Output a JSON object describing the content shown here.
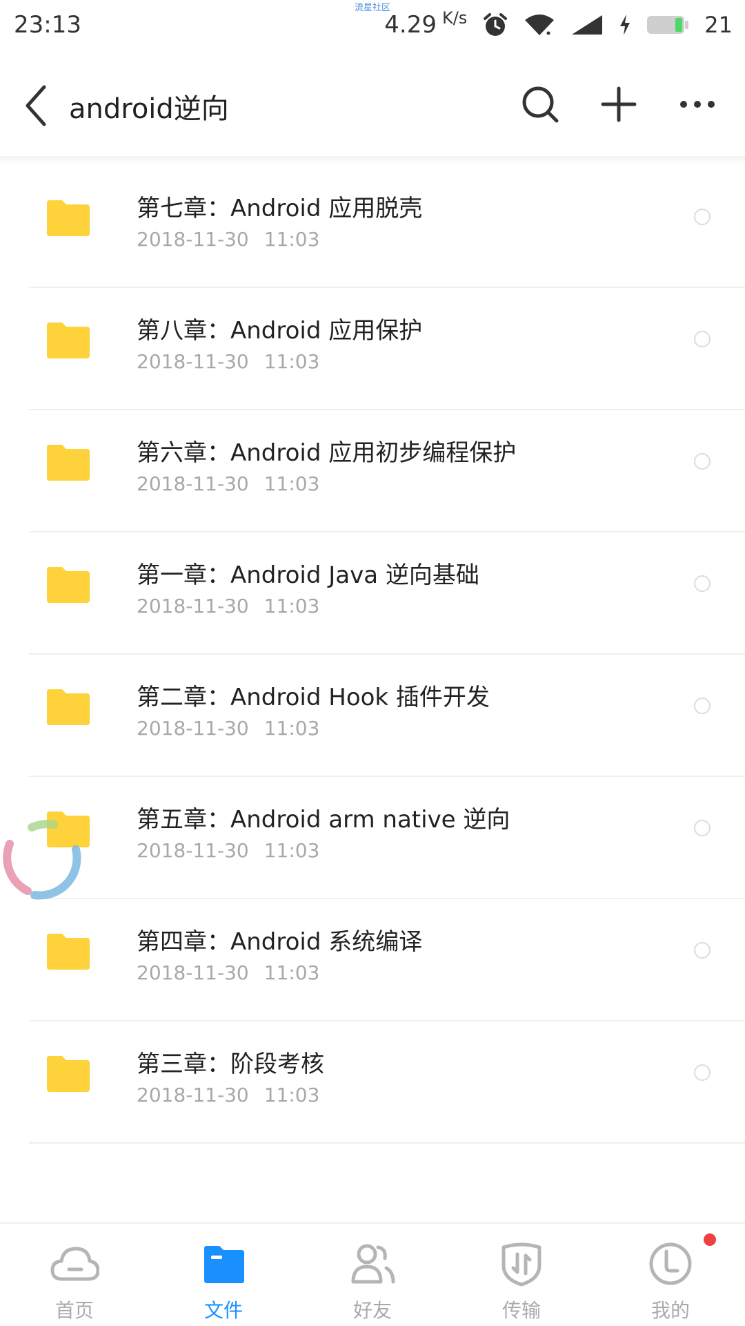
{
  "status_bar": {
    "time": "23:13",
    "watermark": "流星社区",
    "speed": "4.29",
    "speed_unit": "K/s",
    "battery": "21"
  },
  "header": {
    "title": "android逆向"
  },
  "folders": [
    {
      "name": "第七章：Android 应用脱壳",
      "date": "2018-11-30",
      "time": "11:03"
    },
    {
      "name": "第八章：Android 应用保护",
      "date": "2018-11-30",
      "time": "11:03"
    },
    {
      "name": "第六章：Android 应用初步编程保护",
      "date": "2018-11-30",
      "time": "11:03"
    },
    {
      "name": "第一章：Android Java 逆向基础",
      "date": "2018-11-30",
      "time": "11:03"
    },
    {
      "name": "第二章：Android Hook 插件开发",
      "date": "2018-11-30",
      "time": "11:03"
    },
    {
      "name": "第五章：Android arm native 逆向",
      "date": "2018-11-30",
      "time": "11:03"
    },
    {
      "name": "第四章：Android 系统编译",
      "date": "2018-11-30",
      "time": "11:03"
    },
    {
      "name": "第三章：阶段考核",
      "date": "2018-11-30",
      "time": "11:03"
    }
  ],
  "bottom_nav": [
    {
      "label": "首页",
      "icon": "cloud-icon"
    },
    {
      "label": "文件",
      "icon": "folder-icon",
      "active": true
    },
    {
      "label": "好友",
      "icon": "friends-icon"
    },
    {
      "label": "传输",
      "icon": "transfer-icon"
    },
    {
      "label": "我的",
      "icon": "profile-icon",
      "badge": true
    }
  ],
  "colors": {
    "accent": "#1a90ff",
    "folder": "#fdd23a",
    "badge": "#f04040"
  }
}
